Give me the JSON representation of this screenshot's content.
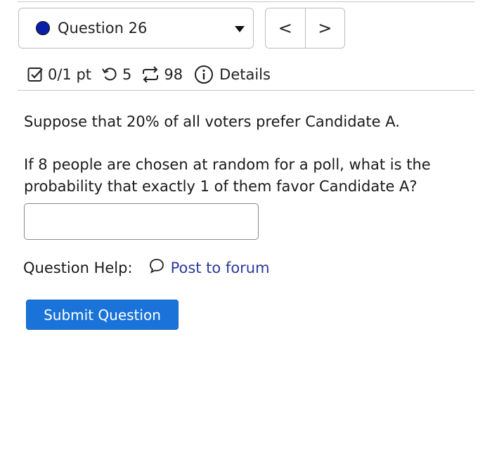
{
  "question_selector": {
    "label": "Question 26",
    "status_color": "#0b1ea8"
  },
  "nav": {
    "prev_label": "<",
    "next_label": ">"
  },
  "meta": {
    "score": "0/1 pt",
    "retries": "5",
    "attempts": "98",
    "details_label": "Details"
  },
  "question": {
    "line1": "Suppose that 20% of all voters prefer Candidate A.",
    "line2": "If 8 people are chosen at random for a poll, what is the probability that exactly 1 of them favor Candidate A?",
    "answer_value": ""
  },
  "help": {
    "label": "Question Help:",
    "forum_label": "Post to forum"
  },
  "submit": {
    "label": "Submit Question"
  },
  "colors": {
    "link": "#2b3a9c",
    "button": "#1a73d9"
  }
}
